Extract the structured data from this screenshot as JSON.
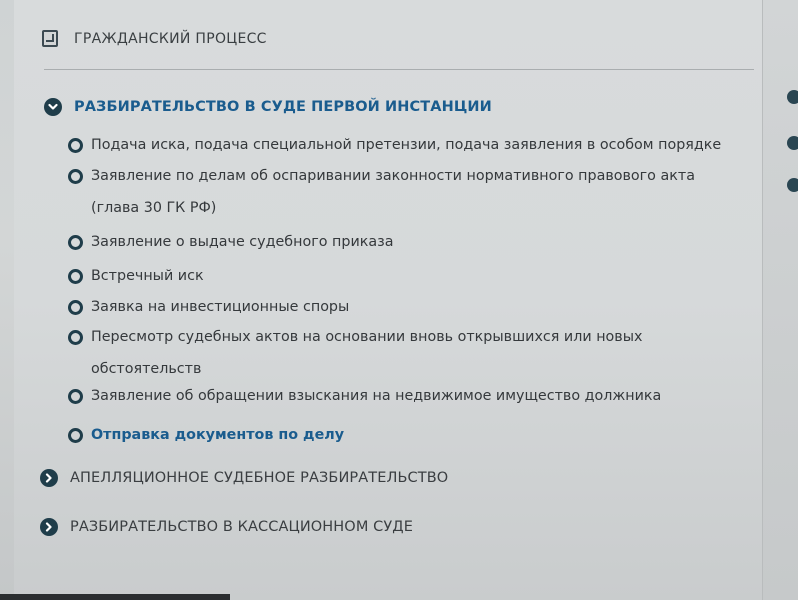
{
  "header": {
    "title": "ГРАЖДАНСКИЙ ПРОЦЕСС",
    "icon": "document-icon"
  },
  "sections": [
    {
      "title": "РАЗБИРАТЕЛЬСТВО В СУДЕ ПЕРВОЙ ИНСТАНЦИИ",
      "expanded": true,
      "icon": "chevron-down-circle-icon",
      "items": [
        {
          "label": "Подача иска, подача специальной претензии, подача заявления в особом порядке"
        },
        {
          "label": "Заявление по делам об оспаривании законности нормативного правового акта (глава 30 ГК РФ)"
        },
        {
          "label": "Заявление о выдаче судебного приказа"
        },
        {
          "label": "Встречный иск"
        },
        {
          "label": "Заявка на инвестиционные споры"
        },
        {
          "label": "Пересмотр судебных актов на основании вновь открывшихся или новых обстоятельств"
        },
        {
          "label": "Заявление об обращении взыскания на недвижимое имущество должника"
        },
        {
          "label": "Отправка документов по делу",
          "highlighted": true
        }
      ]
    },
    {
      "title": "АПЕЛЛЯЦИОННОЕ СУДЕБНОЕ РАЗБИРАТЕЛЬСТВО",
      "expanded": false,
      "icon": "chevron-right-circle-icon"
    },
    {
      "title": "РАЗБИРАТЕЛЬСТВО В КАССАЦИОННОМ СУДЕ",
      "expanded": false,
      "icon": "chevron-right-circle-icon"
    }
  ],
  "colors": {
    "accent": "#1a5c8e",
    "icon": "#1f3d4a",
    "text": "#35393c"
  }
}
